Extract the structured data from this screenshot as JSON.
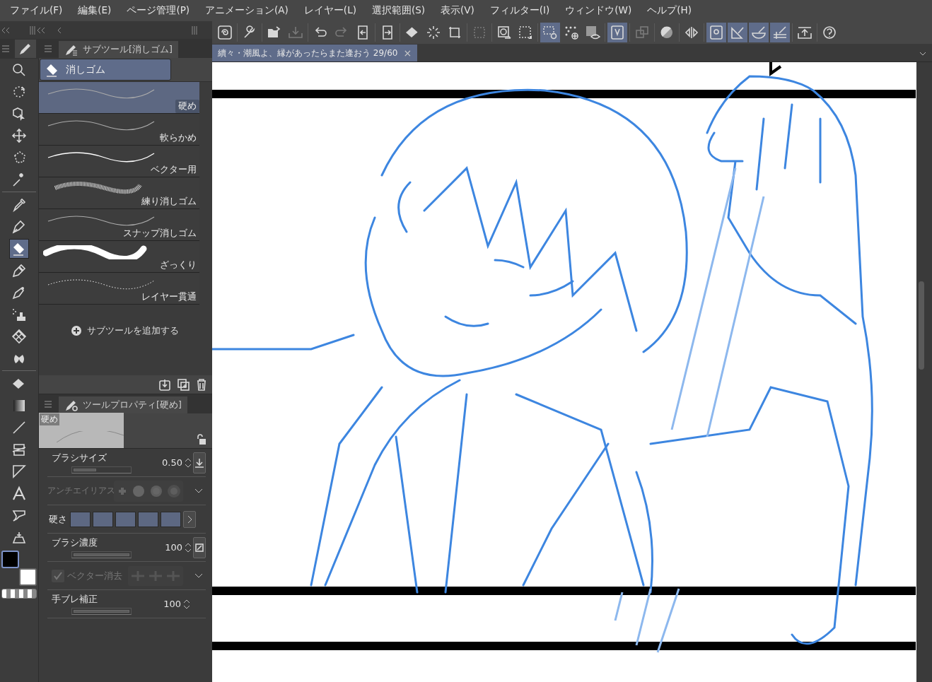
{
  "menu": [
    "ファイル(F)",
    "編集(E)",
    "ページ管理(P)",
    "アニメーション(A)",
    "レイヤー(L)",
    "選択範囲(S)",
    "表示(V)",
    "フィルター(I)",
    "ウィンドウ(W)",
    "ヘルプ(H)"
  ],
  "toolbar": [
    {
      "selected": false,
      "disabled": false
    },
    {
      "selected": false,
      "disabled": false
    },
    {
      "selected": false,
      "disabled": false
    },
    {
      "selected": false,
      "disabled": true
    },
    {
      "selected": false,
      "disabled": false
    },
    {
      "selected": false,
      "disabled": true
    },
    {
      "selected": false,
      "disabled": false
    },
    {
      "selected": false,
      "disabled": false
    },
    {
      "selected": false,
      "disabled": false
    },
    {
      "selected": false,
      "disabled": false
    },
    {
      "selected": false,
      "disabled": false
    },
    {
      "selected": false,
      "disabled": true
    },
    {
      "selected": false,
      "disabled": false
    },
    {
      "selected": false,
      "disabled": false
    },
    {
      "selected": true,
      "disabled": false
    },
    {
      "selected": false,
      "disabled": false
    },
    {
      "selected": false,
      "disabled": false
    },
    {
      "selected": true,
      "disabled": false
    },
    {
      "selected": false,
      "disabled": true
    },
    {
      "selected": false,
      "disabled": false
    },
    {
      "selected": false,
      "disabled": false
    },
    {
      "selected": true,
      "disabled": false
    },
    {
      "selected": true,
      "disabled": false
    },
    {
      "selected": true,
      "disabled": false
    },
    {
      "selected": true,
      "disabled": false
    },
    {
      "selected": false,
      "disabled": false
    },
    {
      "selected": false,
      "disabled": false
    }
  ],
  "tool_groups": [
    {
      "tools": [
        {
          "selected": false
        },
        {
          "selected": false
        },
        {
          "selected": false
        },
        {
          "selected": false
        },
        {
          "selected": false
        },
        {
          "selected": false
        }
      ]
    },
    {
      "tools": [
        {
          "selected": false
        },
        {
          "selected": false
        },
        {
          "selected": true
        },
        {
          "selected": false
        },
        {
          "selected": false
        },
        {
          "selected": false
        },
        {
          "selected": false
        },
        {
          "selected": false
        }
      ]
    },
    {
      "tools": [
        {
          "selected": false
        },
        {
          "selected": false
        },
        {
          "selected": false
        },
        {
          "selected": false
        },
        {
          "selected": false
        },
        {
          "selected": false
        },
        {
          "selected": false
        },
        {
          "selected": false
        }
      ]
    }
  ],
  "colors": [
    {
      "color": "#000000",
      "selected": true
    },
    {
      "color": "#ffffff",
      "selected": false
    }
  ],
  "subtool_panel": {
    "title": "サブツール[消しゴム]",
    "group": "消しゴム",
    "items": [
      {
        "label": "硬め",
        "kind": "soft",
        "selected": true
      },
      {
        "label": "軟らかめ",
        "kind": "soft",
        "selected": false
      },
      {
        "label": "ベクター用",
        "kind": "line",
        "selected": false
      },
      {
        "label": "練り消しゴム",
        "kind": "textured",
        "selected": false
      },
      {
        "label": "スナップ消しゴム",
        "kind": "soft",
        "selected": false
      },
      {
        "label": "ざっくり",
        "kind": "thick",
        "selected": false
      },
      {
        "label": "レイヤー貫通",
        "kind": "dotted",
        "selected": false
      }
    ],
    "add_button": "サブツールを追加する"
  },
  "tool_property": {
    "title": "ツールプロパティ[硬め]",
    "preview_label": "硬め",
    "rows": [
      {
        "kind": "slider",
        "label": "ブラシサイズ",
        "value": "0.50",
        "level": 0.4,
        "disabled": false
      },
      {
        "kind": "dots",
        "label": "アンチエイリアス",
        "disabled": true
      },
      {
        "kind": "swatches",
        "label": "硬さ",
        "disabled": false
      },
      {
        "kind": "slider",
        "label": "ブラシ濃度",
        "value": "100",
        "level": 1,
        "disabled": false
      },
      {
        "kind": "checkbox",
        "label": "ベクター消去",
        "checked": true,
        "disabled": true
      },
      {
        "kind": "slider",
        "label": "手ブレ補正",
        "value": "100",
        "level": 1,
        "disabled": false
      }
    ]
  },
  "document_tab": {
    "title": "續々・潮風よ、縁があったらまた逢おう 29/60",
    "close": "×"
  }
}
